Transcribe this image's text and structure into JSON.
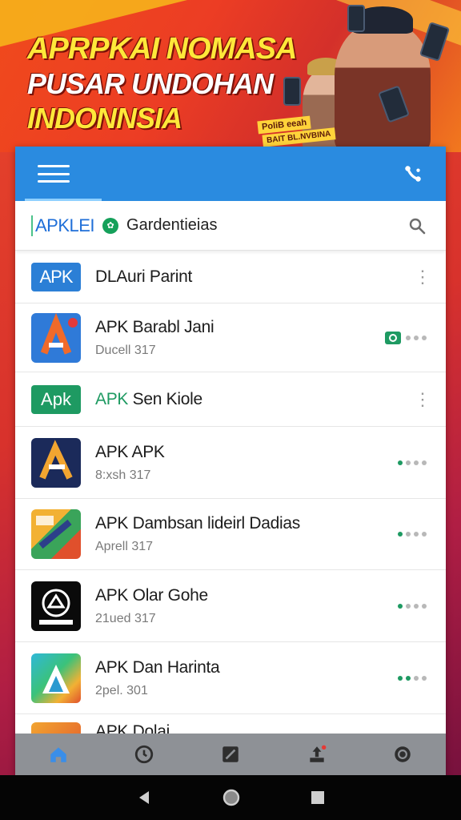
{
  "banner": {
    "line1": "APRPKAI NOMASA",
    "line2": "PUSAR UNDOHAN",
    "line3": "INDONNSIA",
    "tag1": "PoliB eeah",
    "tag2": "BAIT BL.NVBINA"
  },
  "header": {
    "brand": "APKLEI",
    "search_label": "Gardentieias"
  },
  "items": [
    {
      "icon": "apk-text-icon",
      "icon_text": "APK",
      "title": "DLAuri Parint",
      "subtitle": ""
    },
    {
      "icon": "a-triangle-icon",
      "icon_text": "",
      "title": "APK Barabl Jani",
      "subtitle": "Ducell 317"
    },
    {
      "icon": "apk-green-icon",
      "icon_text": "Apk",
      "title_prefix": "APK",
      "title": "Sen Kiole",
      "subtitle": ""
    },
    {
      "icon": "a-dark-icon",
      "icon_text": "",
      "title": "APK APK",
      "subtitle": "8:xsh 317"
    },
    {
      "icon": "map-collage-icon",
      "icon_text": "",
      "title": "APK Dambsan lideirl Dadias",
      "subtitle": "Aprell 317"
    },
    {
      "icon": "emblem-icon",
      "icon_text": "",
      "title": "APK Olar Gohe",
      "subtitle": "21ued 317"
    },
    {
      "icon": "a-gradient-icon",
      "icon_text": "",
      "title": "APK Dan Harinta",
      "subtitle": "2pel. 301"
    },
    {
      "icon": "partial-icon",
      "icon_text": "",
      "title": "APK Dolai",
      "subtitle": ""
    }
  ],
  "nav": [
    "home-icon",
    "clock-icon",
    "edit-icon",
    "share-icon",
    "refresh-icon"
  ],
  "colors": {
    "appbar": "#2a8be0",
    "accent_green": "#1e9a62",
    "brand_blue": "#1f6fd8"
  }
}
